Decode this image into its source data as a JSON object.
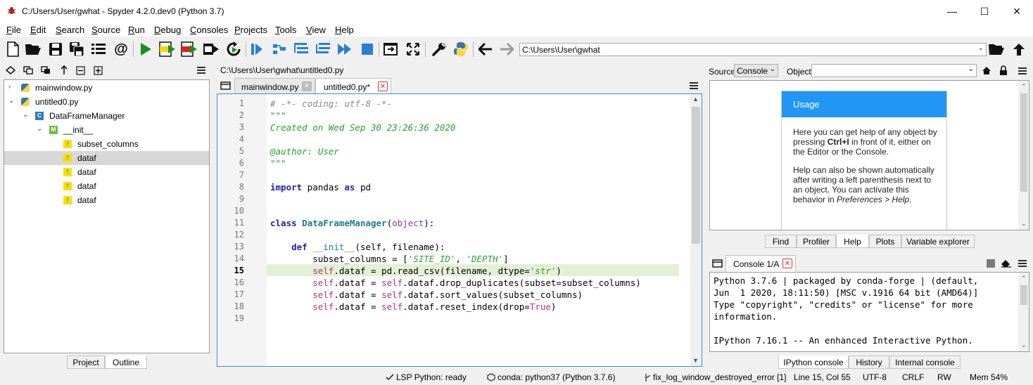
{
  "window": {
    "title": "C:/Users/User/gwhat - Spyder 4.2.0.dev0 (Python 3.7)",
    "controls": {
      "minimize": "—",
      "maximize": "☐",
      "close": "✕"
    }
  },
  "menus": [
    {
      "key": "F",
      "rest": "ile"
    },
    {
      "key": "E",
      "rest": "dit"
    },
    {
      "key": "S",
      "rest": "earch"
    },
    {
      "key": "S",
      "rest": "ource"
    },
    {
      "key": "R",
      "rest": "un"
    },
    {
      "key": "D",
      "rest": "ebug"
    },
    {
      "key": "C",
      "rest": "onsoles"
    },
    {
      "key": "P",
      "rest": "rojects"
    },
    {
      "key": "T",
      "rest": "ools"
    },
    {
      "key": "V",
      "rest": "iew"
    },
    {
      "key": "H",
      "rest": "elp"
    }
  ],
  "toolbar": {
    "working_dir": "C:\\Users\\User\\gwhat"
  },
  "outline": {
    "items": [
      {
        "label": "mainwindow.py",
        "icon": "python-file-icon",
        "depth": 0,
        "arrow": "›"
      },
      {
        "label": "untitled0.py",
        "icon": "python-file-icon",
        "depth": 0,
        "arrow": "⌄"
      },
      {
        "label": "DataFrameManager",
        "icon": "class-icon",
        "depth": 1,
        "arrow": "⌄"
      },
      {
        "label": "__init__",
        "icon": "method-icon",
        "depth": 2,
        "arrow": "⌄"
      },
      {
        "label": "subset_columns",
        "icon": "attribute-icon",
        "depth": 3,
        "arrow": ""
      },
      {
        "label": "dataf",
        "icon": "attribute-icon",
        "depth": 3,
        "arrow": "",
        "selected": true
      },
      {
        "label": "dataf",
        "icon": "attribute-icon",
        "depth": 3,
        "arrow": ""
      },
      {
        "label": "dataf",
        "icon": "attribute-icon",
        "depth": 3,
        "arrow": ""
      },
      {
        "label": "dataf",
        "icon": "attribute-icon",
        "depth": 3,
        "arrow": ""
      }
    ],
    "tabs": [
      "Project",
      "Outline"
    ],
    "active_tab": "Outline"
  },
  "editor": {
    "path": "C:\\Users\\User\\gwhat\\untitled0.py",
    "tabs": [
      {
        "label": "mainwindow.py"
      },
      {
        "label": "untitled0.py*",
        "active": true
      }
    ],
    "current_line": 15,
    "line_numbers": [
      "1",
      "2",
      "3",
      "4",
      "5",
      "6",
      "7",
      "8",
      "9",
      "10",
      "11",
      "12",
      "13",
      "14",
      "15",
      "16",
      "17",
      "18",
      "19"
    ]
  },
  "help": {
    "source_label": "Source",
    "source_value": "Console",
    "object_label": "Object",
    "object_value": "",
    "usage_title": "Usage",
    "usage_p1_a": "Here you can get help of any object by pressing ",
    "usage_p1_key": "Ctrl+I",
    "usage_p1_b": " in front of it, either on the Editor or the Console.",
    "usage_p2_a": "Help can also be shown automatically after writing a left parenthesis next to an object. You can activate this behavior in ",
    "usage_p2_em": "Preferences > Help",
    "usage_p2_b": ".",
    "tabs": [
      "Find",
      "Profiler",
      "Help",
      "Plots",
      "Variable explorer"
    ],
    "active_tab": "Help"
  },
  "console": {
    "tab_label": "Console 1/A",
    "lines": [
      "Python 3.7.6 | packaged by conda-forge | (default,",
      "Jun  1 2020, 18:11:50) [MSC v.1916 64 bit (AMD64)]",
      "Type \"copyright\", \"credits\" or \"license\" for more",
      "information.",
      "",
      "IPython 7.16.1 -- An enhanced Interactive Python."
    ],
    "tabs": [
      "IPython console",
      "History",
      "Internal console"
    ],
    "active_tab": "IPython console"
  },
  "statusbar": {
    "lsp": "LSP Python: ready",
    "conda": "conda: python37 (Python 3.7.6)",
    "branch": "fix_log_window_destroyed_error [1]",
    "position": "Line 15, Col 55",
    "encoding": "UTF-8",
    "eol": "CRLF",
    "rw": "RW",
    "mem": "Mem 54%"
  }
}
